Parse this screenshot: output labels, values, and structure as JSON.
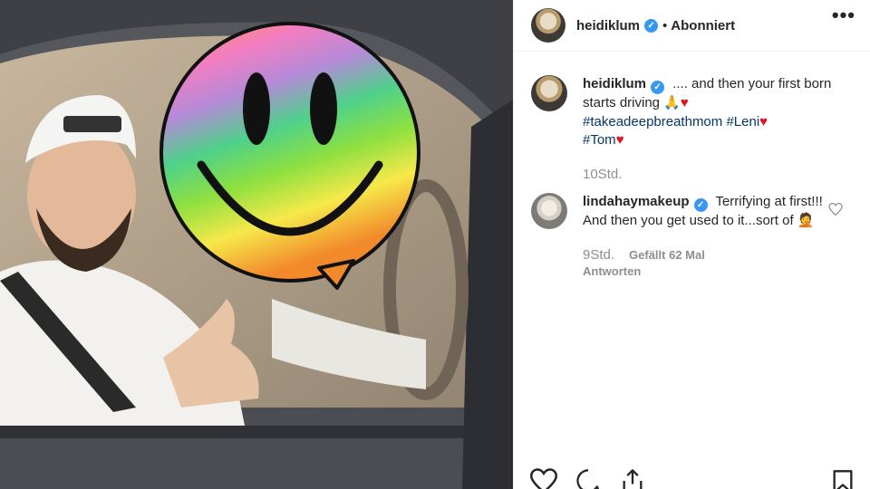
{
  "post": {
    "author": "heidiklum",
    "follow_status": "Abonniert",
    "separator": "•",
    "more_icon": "more-horizontal-icon"
  },
  "caption": {
    "user": "heidiklum",
    "text": ".... and then your first born starts driving",
    "emojis": [
      "folded-hands-icon",
      "red-heart-icon"
    ],
    "hashtags": [
      "#takeadeepbreathmom",
      "#Leni",
      "#Tom"
    ],
    "time": "10Std."
  },
  "comment": {
    "user": "lindahaymakeup",
    "text": "Terrifying at first!!! And then you get used to it...sort of",
    "emoji": "woman-facepalming-icon",
    "time": "9Std.",
    "likes": "Gefällt 62 Mal",
    "reply_label": "Antworten"
  },
  "icons": {
    "verified": "verified-badge-icon",
    "like": "heart-outline-icon",
    "comment": "comment-icon",
    "share": "share-icon",
    "save": "bookmark-icon"
  },
  "colors": {
    "link": "#00376b",
    "verified": "#3897f0",
    "muted": "#8e8e8e",
    "heart": "#e0141e"
  }
}
